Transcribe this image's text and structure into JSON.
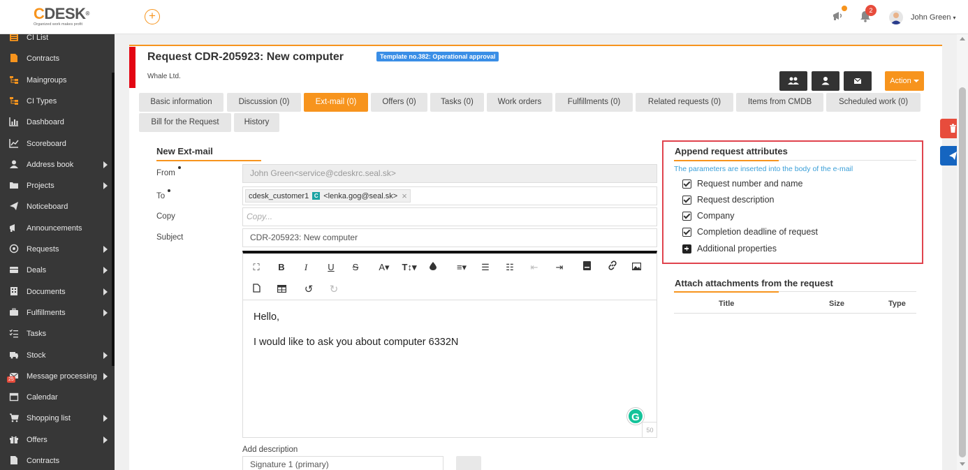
{
  "header": {
    "logo_text": "DESK",
    "logo_c": "C",
    "logo_tagline": "Organized work makes profit",
    "notifications_count": "2",
    "user_name": "John Green"
  },
  "sidebar": {
    "items": [
      {
        "label": "CI List",
        "icon": "list-icon"
      },
      {
        "label": "Contracts",
        "icon": "document-icon"
      },
      {
        "label": "Maingroups",
        "icon": "tree-icon"
      },
      {
        "label": "CI Types",
        "icon": "tree-icon"
      },
      {
        "label": "Dashboard",
        "icon": "dashboard-icon"
      },
      {
        "label": "Scoreboard",
        "icon": "chart-line-icon"
      },
      {
        "label": "Address book",
        "icon": "person-icon"
      },
      {
        "label": "Projects",
        "icon": "folder-icon"
      },
      {
        "label": "Noticeboard",
        "icon": "paper-plane-icon"
      },
      {
        "label": "Announcements",
        "icon": "megaphone-icon"
      },
      {
        "label": "Requests",
        "icon": "target-icon"
      },
      {
        "label": "Deals",
        "icon": "box-icon"
      },
      {
        "label": "Documents",
        "icon": "building-icon"
      },
      {
        "label": "Fulfillments",
        "icon": "briefcase-icon"
      },
      {
        "label": "Tasks",
        "icon": "tasks-icon"
      },
      {
        "label": "Stock",
        "icon": "truck-icon"
      },
      {
        "label": "Message processing",
        "icon": "envelope-icon",
        "badge": "25"
      },
      {
        "label": "Calendar",
        "icon": "calendar-icon"
      },
      {
        "label": "Shopping list",
        "icon": "cart-icon"
      },
      {
        "label": "Offers",
        "icon": "gift-icon"
      },
      {
        "label": "Contracts",
        "icon": "file-icon"
      }
    ]
  },
  "request": {
    "title": "Request CDR-205923: New computer",
    "template_badge": "Template no.382: Operational approval",
    "company": "Whale Ltd.",
    "action_label": "Action"
  },
  "tabs": [
    {
      "label": "Basic information"
    },
    {
      "label": "Discussion (0)"
    },
    {
      "label": "Ext-mail (0)",
      "active": true
    },
    {
      "label": "Offers (0)"
    },
    {
      "label": "Tasks (0)"
    },
    {
      "label": "Work orders"
    },
    {
      "label": "Fulfillments (0)"
    },
    {
      "label": "Related requests (0)"
    },
    {
      "label": "Items from CMDB"
    },
    {
      "label": "Scheduled work (0)"
    },
    {
      "label": "Bill for the Request"
    },
    {
      "label": "History"
    }
  ],
  "form": {
    "title": "New Ext-mail",
    "from_label": "From",
    "from_value": "John Green<service@cdeskrc.seal.sk>",
    "to_label": "To",
    "to_chip_name": "cdesk_customer1",
    "to_chip_badge": "C",
    "to_chip_email": "<lenka.gog@seal.sk>",
    "copy_label": "Copy",
    "copy_placeholder": "Copy...",
    "subject_label": "Subject",
    "subject_value": "CDR-205923: New computer",
    "body_line1": "Hello,",
    "body_line2": "I would like to ask you about computer 6332N",
    "char_counter": "50",
    "add_description_label": "Add description",
    "signature_value": "Signature 1 (primary)"
  },
  "append": {
    "title": "Append request attributes",
    "hint": "The parameters are inserted into the body of the e-mail",
    "options": [
      {
        "label": "Request number and name",
        "checked": true
      },
      {
        "label": "Request description",
        "checked": true
      },
      {
        "label": "Company",
        "checked": true
      },
      {
        "label": "Completion deadline of request",
        "checked": true
      },
      {
        "label": "Additional properties",
        "checked": false
      }
    ]
  },
  "attachments": {
    "title": "Attach attachments from the request",
    "col_title": "Title",
    "col_size": "Size",
    "col_type": "Type"
  },
  "colors": {
    "accent": "#f7941d",
    "sidebar_bg": "#373737",
    "highlight_border": "#e0434d",
    "template_badge": "#3a8ee6",
    "delete_button": "#e74c3c",
    "send_button": "#1565c0"
  }
}
